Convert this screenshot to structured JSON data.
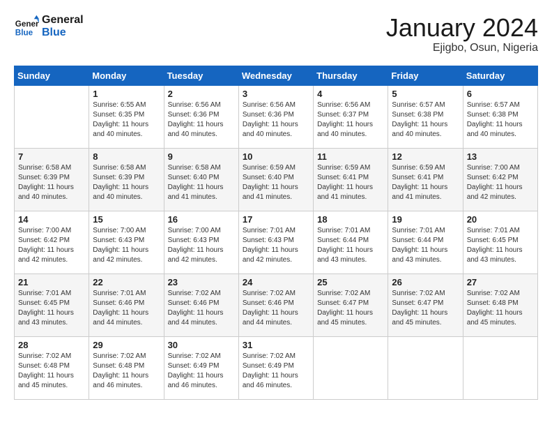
{
  "header": {
    "logo_general": "General",
    "logo_blue": "Blue",
    "month": "January 2024",
    "location": "Ejigbo, Osun, Nigeria"
  },
  "days_of_week": [
    "Sunday",
    "Monday",
    "Tuesday",
    "Wednesday",
    "Thursday",
    "Friday",
    "Saturday"
  ],
  "weeks": [
    [
      {
        "day": "",
        "info": ""
      },
      {
        "day": "1",
        "info": "Sunrise: 6:55 AM\nSunset: 6:35 PM\nDaylight: 11 hours\nand 40 minutes."
      },
      {
        "day": "2",
        "info": "Sunrise: 6:56 AM\nSunset: 6:36 PM\nDaylight: 11 hours\nand 40 minutes."
      },
      {
        "day": "3",
        "info": "Sunrise: 6:56 AM\nSunset: 6:36 PM\nDaylight: 11 hours\nand 40 minutes."
      },
      {
        "day": "4",
        "info": "Sunrise: 6:56 AM\nSunset: 6:37 PM\nDaylight: 11 hours\nand 40 minutes."
      },
      {
        "day": "5",
        "info": "Sunrise: 6:57 AM\nSunset: 6:38 PM\nDaylight: 11 hours\nand 40 minutes."
      },
      {
        "day": "6",
        "info": "Sunrise: 6:57 AM\nSunset: 6:38 PM\nDaylight: 11 hours\nand 40 minutes."
      }
    ],
    [
      {
        "day": "7",
        "info": "Sunrise: 6:58 AM\nSunset: 6:39 PM\nDaylight: 11 hours\nand 40 minutes."
      },
      {
        "day": "8",
        "info": "Sunrise: 6:58 AM\nSunset: 6:39 PM\nDaylight: 11 hours\nand 40 minutes."
      },
      {
        "day": "9",
        "info": "Sunrise: 6:58 AM\nSunset: 6:40 PM\nDaylight: 11 hours\nand 41 minutes."
      },
      {
        "day": "10",
        "info": "Sunrise: 6:59 AM\nSunset: 6:40 PM\nDaylight: 11 hours\nand 41 minutes."
      },
      {
        "day": "11",
        "info": "Sunrise: 6:59 AM\nSunset: 6:41 PM\nDaylight: 11 hours\nand 41 minutes."
      },
      {
        "day": "12",
        "info": "Sunrise: 6:59 AM\nSunset: 6:41 PM\nDaylight: 11 hours\nand 41 minutes."
      },
      {
        "day": "13",
        "info": "Sunrise: 7:00 AM\nSunset: 6:42 PM\nDaylight: 11 hours\nand 42 minutes."
      }
    ],
    [
      {
        "day": "14",
        "info": "Sunrise: 7:00 AM\nSunset: 6:42 PM\nDaylight: 11 hours\nand 42 minutes."
      },
      {
        "day": "15",
        "info": "Sunrise: 7:00 AM\nSunset: 6:43 PM\nDaylight: 11 hours\nand 42 minutes."
      },
      {
        "day": "16",
        "info": "Sunrise: 7:00 AM\nSunset: 6:43 PM\nDaylight: 11 hours\nand 42 minutes."
      },
      {
        "day": "17",
        "info": "Sunrise: 7:01 AM\nSunset: 6:43 PM\nDaylight: 11 hours\nand 42 minutes."
      },
      {
        "day": "18",
        "info": "Sunrise: 7:01 AM\nSunset: 6:44 PM\nDaylight: 11 hours\nand 43 minutes."
      },
      {
        "day": "19",
        "info": "Sunrise: 7:01 AM\nSunset: 6:44 PM\nDaylight: 11 hours\nand 43 minutes."
      },
      {
        "day": "20",
        "info": "Sunrise: 7:01 AM\nSunset: 6:45 PM\nDaylight: 11 hours\nand 43 minutes."
      }
    ],
    [
      {
        "day": "21",
        "info": "Sunrise: 7:01 AM\nSunset: 6:45 PM\nDaylight: 11 hours\nand 43 minutes."
      },
      {
        "day": "22",
        "info": "Sunrise: 7:01 AM\nSunset: 6:46 PM\nDaylight: 11 hours\nand 44 minutes."
      },
      {
        "day": "23",
        "info": "Sunrise: 7:02 AM\nSunset: 6:46 PM\nDaylight: 11 hours\nand 44 minutes."
      },
      {
        "day": "24",
        "info": "Sunrise: 7:02 AM\nSunset: 6:46 PM\nDaylight: 11 hours\nand 44 minutes."
      },
      {
        "day": "25",
        "info": "Sunrise: 7:02 AM\nSunset: 6:47 PM\nDaylight: 11 hours\nand 45 minutes."
      },
      {
        "day": "26",
        "info": "Sunrise: 7:02 AM\nSunset: 6:47 PM\nDaylight: 11 hours\nand 45 minutes."
      },
      {
        "day": "27",
        "info": "Sunrise: 7:02 AM\nSunset: 6:48 PM\nDaylight: 11 hours\nand 45 minutes."
      }
    ],
    [
      {
        "day": "28",
        "info": "Sunrise: 7:02 AM\nSunset: 6:48 PM\nDaylight: 11 hours\nand 45 minutes."
      },
      {
        "day": "29",
        "info": "Sunrise: 7:02 AM\nSunset: 6:48 PM\nDaylight: 11 hours\nand 46 minutes."
      },
      {
        "day": "30",
        "info": "Sunrise: 7:02 AM\nSunset: 6:49 PM\nDaylight: 11 hours\nand 46 minutes."
      },
      {
        "day": "31",
        "info": "Sunrise: 7:02 AM\nSunset: 6:49 PM\nDaylight: 11 hours\nand 46 minutes."
      },
      {
        "day": "",
        "info": ""
      },
      {
        "day": "",
        "info": ""
      },
      {
        "day": "",
        "info": ""
      }
    ]
  ]
}
